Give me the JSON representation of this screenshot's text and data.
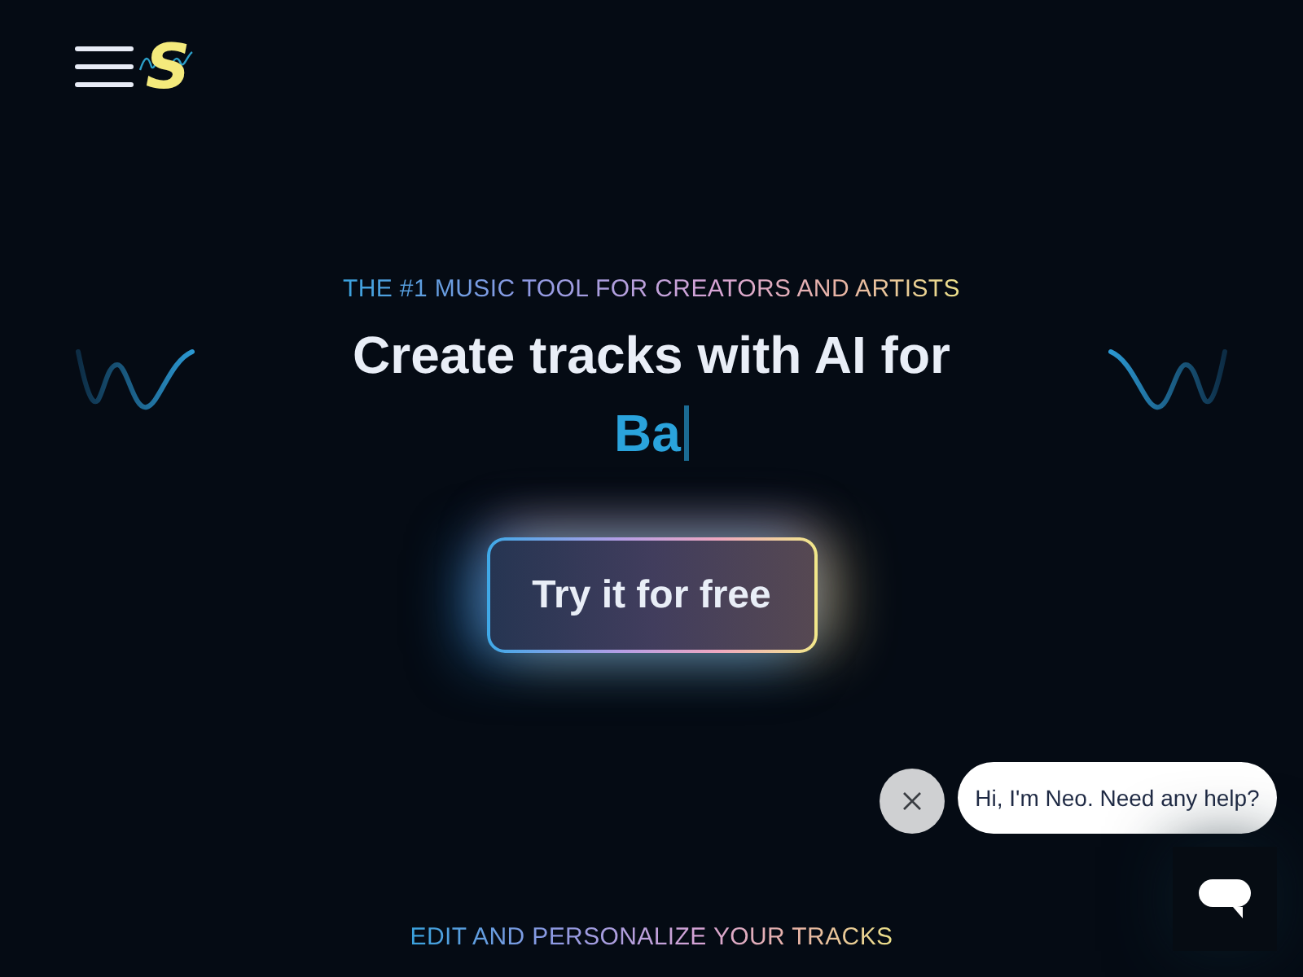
{
  "header": {
    "logo_letter": "S"
  },
  "hero": {
    "eyebrow": "THE #1 MUSIC TOOL FOR CREATORS AND ARTISTS",
    "headline": "Create tracks with AI for",
    "typed_text": "Ba",
    "cta": "Try it for free"
  },
  "chat_widget": {
    "greeting": "Hi, I'm Neo. Need any help?"
  },
  "next_section": {
    "eyebrow": "EDIT AND PERSONALIZE YOUR TRACKS"
  }
}
